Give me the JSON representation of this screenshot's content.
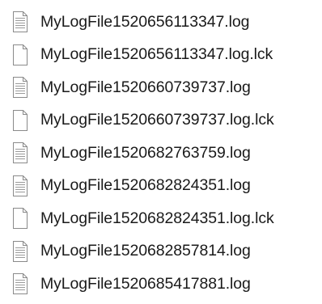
{
  "files": [
    {
      "name": "MyLogFile1520656113347.log",
      "icon": "text-document-icon"
    },
    {
      "name": "MyLogFile1520656113347.log.lck",
      "icon": "blank-document-icon"
    },
    {
      "name": "MyLogFile1520660739737.log",
      "icon": "text-document-icon"
    },
    {
      "name": "MyLogFile1520660739737.log.lck",
      "icon": "blank-document-icon"
    },
    {
      "name": "MyLogFile1520682763759.log",
      "icon": "text-document-icon"
    },
    {
      "name": "MyLogFile1520682824351.log",
      "icon": "text-document-icon"
    },
    {
      "name": "MyLogFile1520682824351.log.lck",
      "icon": "blank-document-icon"
    },
    {
      "name": "MyLogFile1520682857814.log",
      "icon": "text-document-icon"
    },
    {
      "name": "MyLogFile1520685417881.log",
      "icon": "text-document-icon"
    }
  ],
  "colors": {
    "text": "#1a1a1a",
    "icon_outline": "#8a8a8a",
    "icon_lines": "#9a9a9a",
    "icon_fill": "#ffffff"
  }
}
